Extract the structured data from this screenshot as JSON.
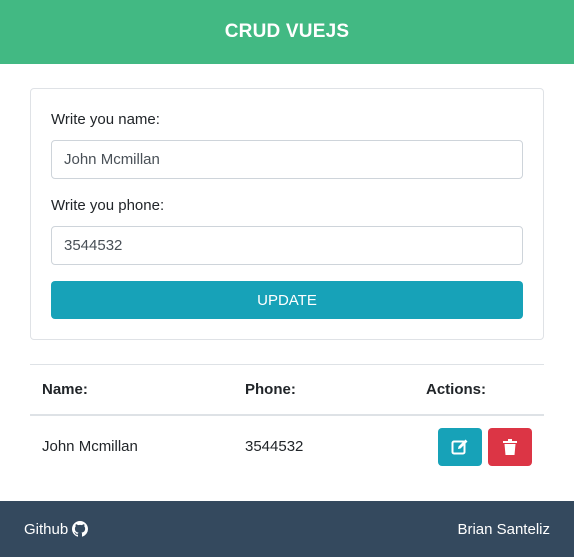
{
  "header": {
    "title": "CRUD VUEJS"
  },
  "form": {
    "name_label": "Write you name:",
    "name_value": "John Mcmillan",
    "phone_label": "Write you phone:",
    "phone_value": "3544532",
    "submit_label": "UPDATE"
  },
  "table": {
    "headers": [
      "Name:",
      "Phone:",
      "Actions:"
    ],
    "rows": [
      {
        "name": "John Mcmillan",
        "phone": "3544532",
        "actions": [
          "edit-icon",
          "trash-icon"
        ]
      }
    ]
  },
  "footer": {
    "link_label": "Github",
    "link_icon": "github-icon",
    "author": "Brian Santeliz"
  },
  "colors": {
    "header": "#42b983",
    "primary_button": "#17a2b8",
    "danger_button": "#dc3545",
    "footer": "#34495e"
  }
}
